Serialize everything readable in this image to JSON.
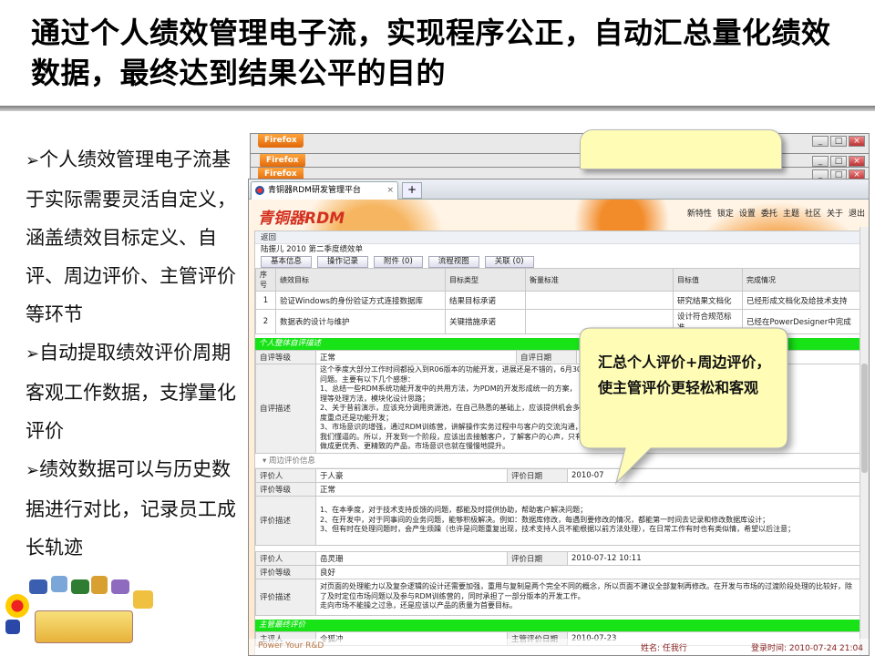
{
  "slide": {
    "title": "通过个人绩效管理电子流，实现程序公正，自动汇总量化绩效数据，最终达到结果公平的目的",
    "bullets": [
      {
        "arrow": "➢",
        "text": "个人绩效管理电子流基于实际需要灵活自定义，涵盖绩效目标定义、自评、周边评价、主管评价等环节"
      },
      {
        "arrow": "➢",
        "text": "自动提取绩效评价周期客观工作数据，支撑量化评价"
      },
      {
        "arrow": "➢",
        "text": "绩效数据可以与历史数据进行对比，记录员工成长轨迹"
      }
    ],
    "callout": "汇总个人评价+周边评价，使主管评价更轻松和客观"
  },
  "browser": {
    "firefox_label": "Firefox",
    "tab_title": "青铜器RDM研发管理平台",
    "tab_close": "×",
    "tab_new": "+",
    "controls": {
      "min": "_",
      "max": "□",
      "close": "×"
    }
  },
  "app": {
    "logo": "青铜器RDM",
    "nav": [
      "新特性",
      "锁定",
      "设置",
      "委托",
      "主题",
      "社区",
      "关于",
      "退出"
    ],
    "back": "返回",
    "page_title": "陆振儿 2010 第二季度绩效单",
    "tabs": [
      "基本信息",
      "操作记录",
      "附件 (0)",
      "流程视图",
      "关联 (0)"
    ],
    "goal_table": {
      "headers": [
        "序号",
        "绩效目标",
        "目标类型",
        "衡量标准",
        "目标值",
        "完成情况"
      ],
      "rows": [
        [
          "1",
          "验证Windows的身份验证方式连接数据库",
          "结果目标承诺",
          "",
          "研究结果文档化",
          "已经形成文档化及给技术支持"
        ],
        [
          "2",
          "数据表的设计与维护",
          "关键措施承诺",
          "",
          "设计符合规范标准",
          "已经在PowerDesigner中完成"
        ]
      ]
    },
    "self_eval": {
      "bar": "个人整体自评描述",
      "grade_label": "自评等级",
      "grade": "正常",
      "date_label": "自评日期",
      "date": "2010-0",
      "desc_label": "自评描述",
      "desc_lines": [
        "这个季度大部分工作时间都投入到R06版本的功能开发，进展还是不错的，6月30日",
        "问题。主要有以下几个感想：",
        "1、总结一些RDM系统功能开发中的共用方法，为PDM的开发形成统一的方案，",
        "理等处理方法，模块化设计思路；",
        "2、关于昔前演示，应该充分调用资源池，在自己熟悉的基础上，应该提供机会多",
        "度重点还是功能开发；",
        "3、市场意识的增强，通过RDM训练营，讲解操作实务过程中与客户的交流沟通，",
        "我们懂逼的。所以，开发到一个阶段，应该出去接触客户，了解客户的心声，只有",
        "做成更优秀、更精致的产品，市场意识也就在慢慢地提升。"
      ]
    },
    "peer_section": "周边评价信息",
    "peer_evals": [
      {
        "rater_label": "评价人",
        "rater": "于人豪",
        "date_label": "评价日期",
        "date": "2010-07",
        "grade_label": "评价等级",
        "grade": "正常",
        "desc_label": "评价描述",
        "desc_lines": [
          "1、在本季度，对于技术支持反馈的问题，都能及时提供协助，帮助客户解决问题；",
          "2、在开发中，对于同事间的业务问题，能够积极解决。例如：数据库修改，每遇到要修改的情况，都能第一时间去记录和修改数据库设计；",
          "3、但有时在处理问题时，会产生烦躁（也许是问题重复出现，技术支持人员不能根据以前方法处理），在日常工作有时也有类似情，希望以后注意；"
        ]
      },
      {
        "rater_label": "评价人",
        "rater": "岳灵珊",
        "date_label": "评价日期",
        "date": "2010-07-12 10:11",
        "grade_label": "评价等级",
        "grade": "良好",
        "desc_label": "评价描述",
        "desc_lines": [
          "对页面的处理能力以及复杂逻辑的设计还需要加强，重用与复制是两个完全不同的概念，所以页面不建议全部复制再修改。在开发与市场的过渡阶段处理的比较好，除了及时定位市场问题以及参与RDM训练营的，同时承担了一部分版本的开发工作。",
          "走向市场不能操之过急，还是应该以产品的质量为首要目标。"
        ]
      }
    ],
    "manager": {
      "bar": "主管最终评价",
      "rater_label": "主评人",
      "rater": "令狐冲",
      "date_label": "主管评价日期",
      "date": "2010-07-23"
    },
    "status": {
      "brand": "Power Your R&D",
      "user": "姓名: 任我行",
      "time": "登录时间: 2010-07-24 21:04"
    }
  }
}
